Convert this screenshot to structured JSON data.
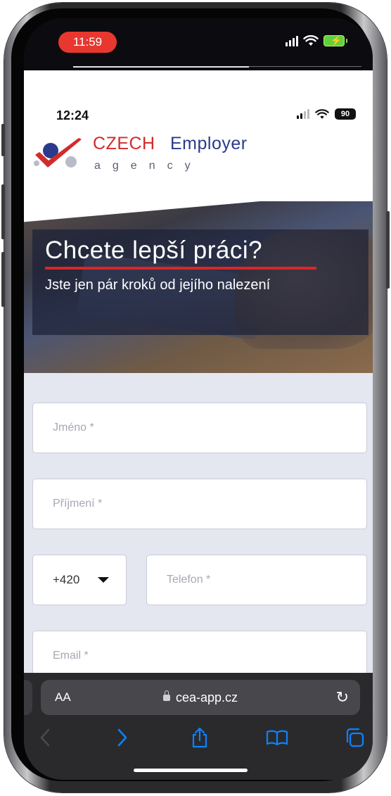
{
  "device": {
    "outer_time": "11:59",
    "outer_time_color": "#e8372f",
    "battery_charging": true
  },
  "inner_status": {
    "time": "12:24",
    "battery": "90"
  },
  "brand": {
    "czech": "CZECH",
    "employer": "Employer",
    "tagline": "agency",
    "primary_red": "#d22b2b",
    "primary_blue": "#2c3a8c"
  },
  "hero": {
    "title": "Chcete lepší práci?",
    "subtitle": "Jste jen pár kroků od jejího nalezení",
    "accent": "#e02424"
  },
  "form": {
    "first_name_placeholder": "Jméno *",
    "last_name_placeholder": "Příjmení *",
    "country_code": "+420",
    "phone_placeholder": "Telefon *",
    "email_placeholder": "Email *",
    "background": "#e4e7f0"
  },
  "browser": {
    "aa_label": "AA",
    "url": "cea-app.cz",
    "icons": [
      "back-icon",
      "forward-icon",
      "share-icon",
      "bookmarks-icon",
      "tabs-icon",
      "reload-icon",
      "lock-icon"
    ],
    "accent": "#0a84ff"
  }
}
